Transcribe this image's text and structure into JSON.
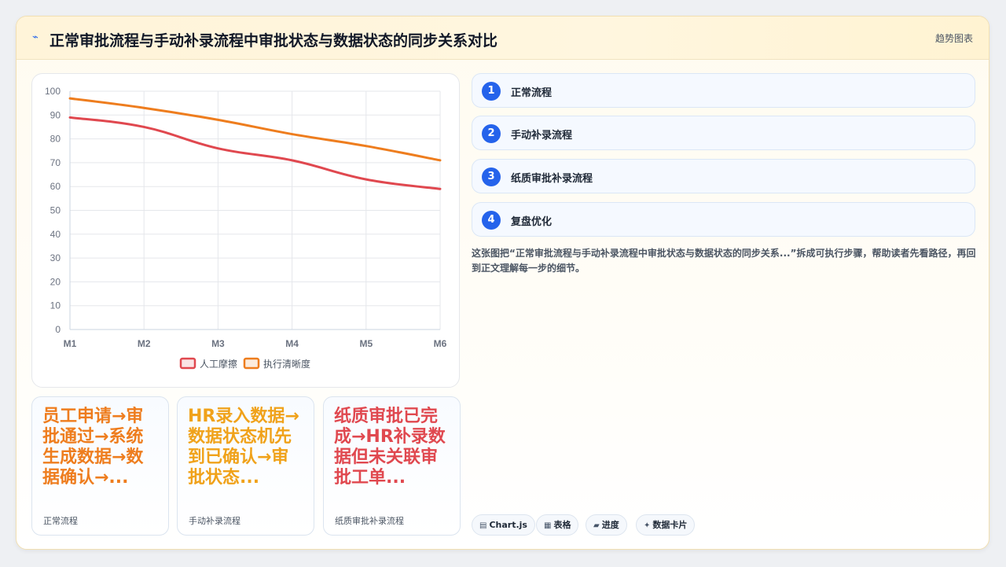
{
  "header": {
    "icon": "chart-trend-icon",
    "title": "正常审批流程与手动补录流程中审批状态与数据状态的同步关系对比",
    "right_label": "趋势图表"
  },
  "chart_data": {
    "type": "line",
    "categories": [
      "M1",
      "M2",
      "M3",
      "M4",
      "M5",
      "M6"
    ],
    "ylim": [
      0,
      100
    ],
    "yticks": [
      0,
      10,
      20,
      30,
      40,
      50,
      60,
      70,
      80,
      90,
      100
    ],
    "grid": true,
    "legend_position": "bottom",
    "series": [
      {
        "name": "人工摩擦",
        "color": "#e0484f",
        "values": [
          89,
          85,
          76,
          71,
          63,
          59
        ]
      },
      {
        "name": "执行清晰度",
        "color": "#ee7d1e",
        "values": [
          97,
          93,
          88,
          82,
          77,
          71
        ]
      }
    ]
  },
  "stat_cards": [
    {
      "big": "员工申请→审批通过→系统生成数据→数据确认→...",
      "label": "正常流程",
      "color": "#ee7d1e"
    },
    {
      "big": "HR录入数据→数据状态机先到已确认→审批状态...",
      "label": "手动补录流程",
      "color": "#f0a21a"
    },
    {
      "big": "纸质审批已完成→HR补录数据但未关联审批工单...",
      "label": "纸质审批补录流程",
      "color": "#e0484f"
    }
  ],
  "steps": [
    {
      "num": "1",
      "label": "正常流程"
    },
    {
      "num": "2",
      "label": "手动补录流程"
    },
    {
      "num": "3",
      "label": "纸质审批补录流程"
    },
    {
      "num": "4",
      "label": "复盘优化"
    }
  ],
  "description": "这张图把“正常审批流程与手动补录流程中审批状态与数据状态的同步关系...”拆成可执行步骤，帮助读者先看路径，再回到正文理解每一步的细节。",
  "tags": [
    {
      "icon": "chart-icon",
      "glyph": "▤",
      "label": "Chart.js"
    },
    {
      "icon": "table-icon",
      "glyph": "▦",
      "label": "表格"
    },
    {
      "icon": "progress-icon",
      "glyph": "▰",
      "label": "进度"
    },
    {
      "icon": "data-card-icon",
      "glyph": "✦",
      "label": "数据卡片"
    }
  ]
}
